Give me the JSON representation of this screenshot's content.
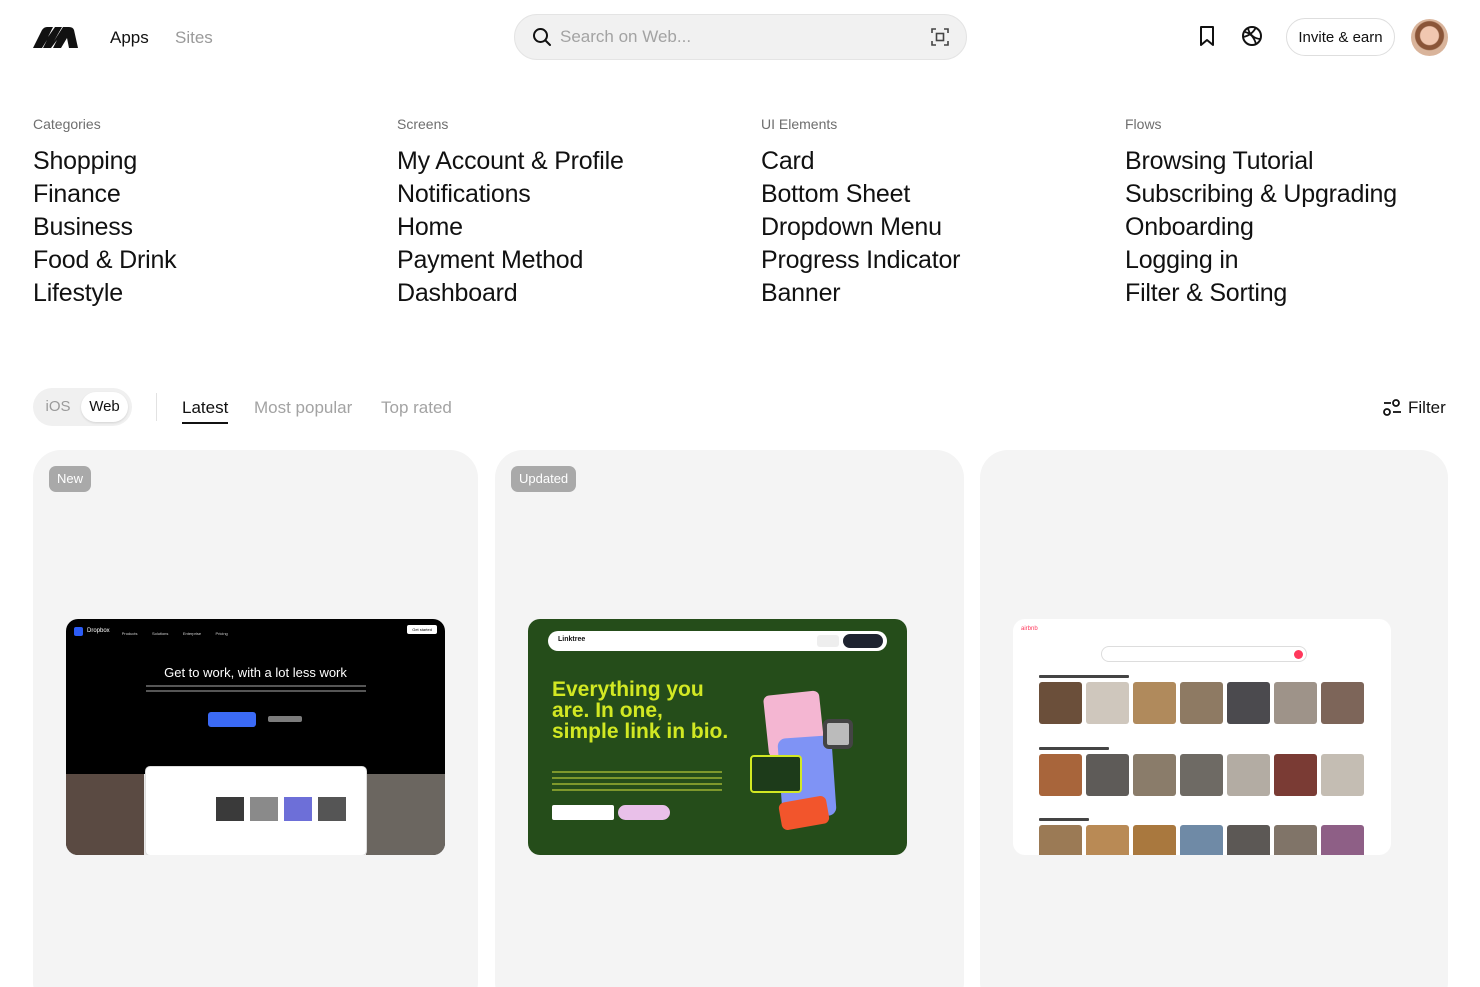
{
  "header": {
    "nav": {
      "apps": "Apps",
      "sites": "Sites"
    },
    "search": {
      "placeholder": "Search on Web..."
    },
    "invite_label": "Invite & earn"
  },
  "menu": {
    "columns": [
      {
        "heading": "Categories",
        "items": [
          "Shopping",
          "Finance",
          "Business",
          "Food & Drink",
          "Lifestyle"
        ]
      },
      {
        "heading": "Screens",
        "items": [
          "My Account & Profile",
          "Notifications",
          "Home",
          "Payment Method",
          "Dashboard"
        ]
      },
      {
        "heading": "UI Elements",
        "items": [
          "Card",
          "Bottom Sheet",
          "Dropdown Menu",
          "Progress Indicator",
          "Banner"
        ]
      },
      {
        "heading": "Flows",
        "items": [
          "Browsing Tutorial",
          "Subscribing & Upgrading",
          "Onboarding",
          "Logging in",
          "Filter & Sorting"
        ]
      }
    ]
  },
  "toolbar": {
    "platforms": {
      "ios": "iOS",
      "web": "Web",
      "selected": "Web"
    },
    "tabs": [
      {
        "label": "Latest",
        "active": true
      },
      {
        "label": "Most popular",
        "active": false
      },
      {
        "label": "Top rated",
        "active": false
      }
    ],
    "filter_label": "Filter"
  },
  "cards": [
    {
      "badge": "New",
      "preview": {
        "name": "Dropbox",
        "nav_links": [
          "Products",
          "Solutions",
          "Enterprise",
          "Pricing"
        ],
        "cta": "Get started",
        "headline": "Get to work, with a lot less work"
      }
    },
    {
      "badge": "Updated",
      "preview": {
        "name": "Linktree",
        "headline": "Everything you are. In one, simple link in bio."
      }
    },
    {
      "badge": "",
      "preview": {
        "name": "airbnb"
      }
    }
  ],
  "colors": {
    "accent": "#111111",
    "muted": "#9a9a9a",
    "card_bg": "#f4f4f4",
    "badge_bg": "#a9a9a9",
    "dropbox_blue": "#2c5cf6",
    "linktree_green": "#254d1a",
    "linktree_lime": "#d2e823",
    "airbnb_red": "#ff385c"
  },
  "icons": [
    "brand-logo-icon",
    "search-icon",
    "scan-icon",
    "bookmark-icon",
    "globe-icon",
    "filter-icon"
  ]
}
